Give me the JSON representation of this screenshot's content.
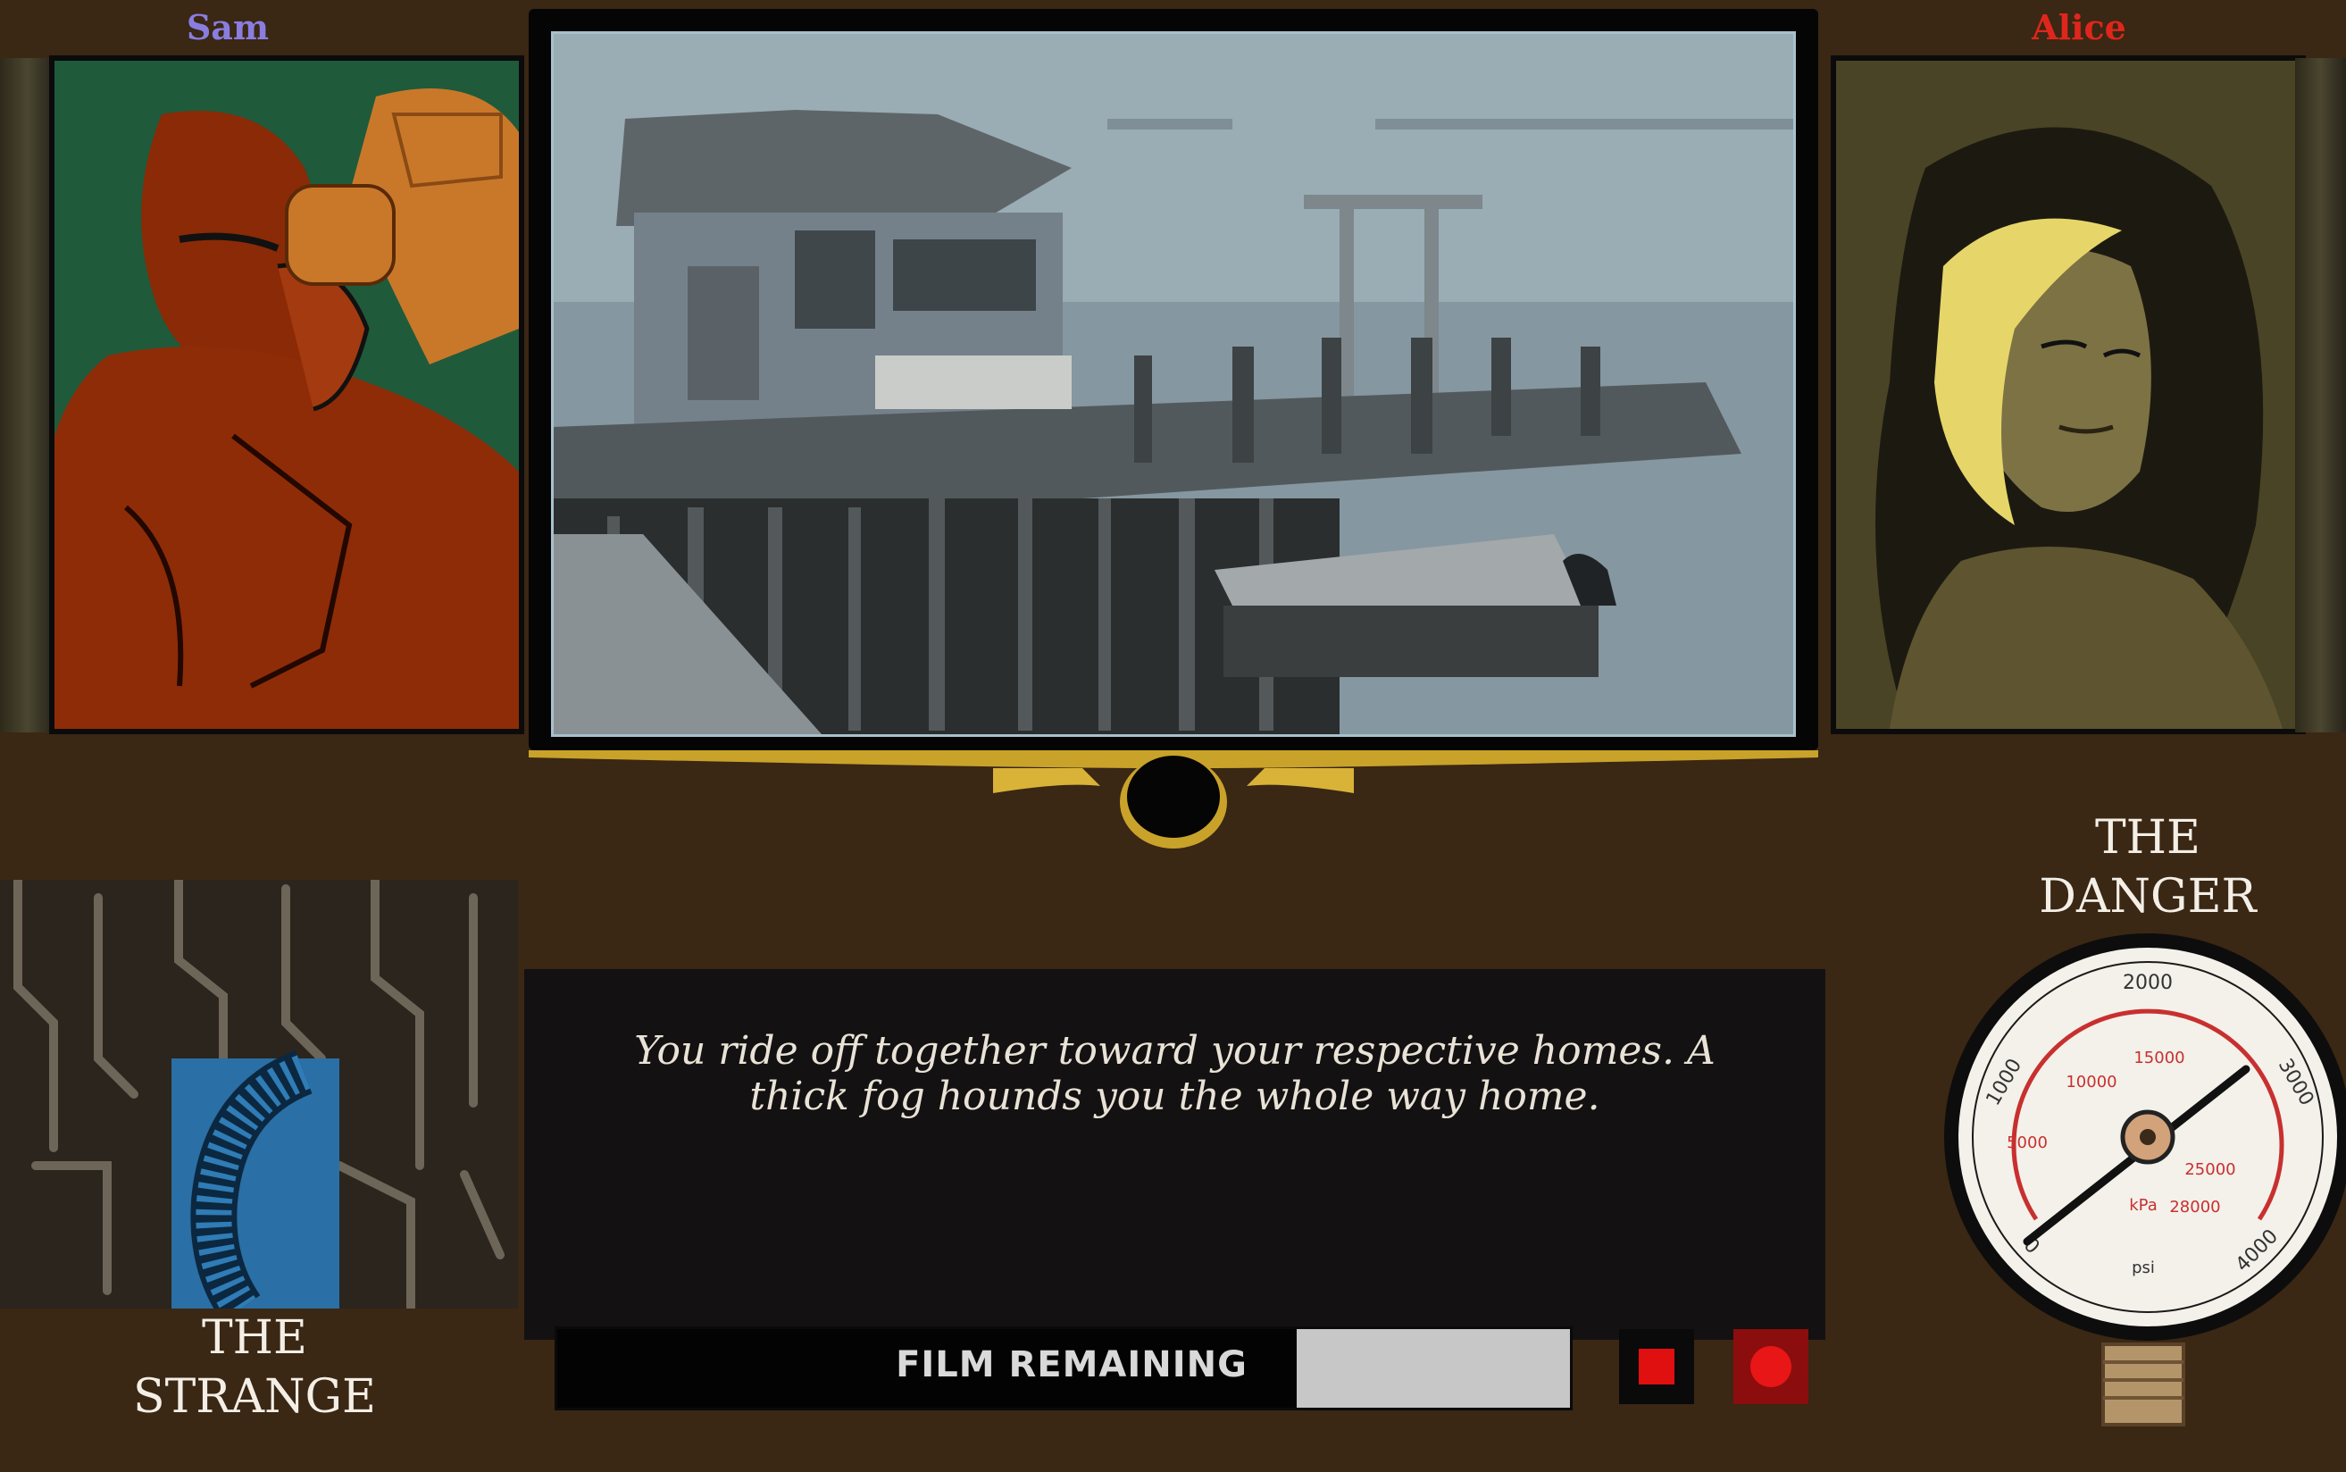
{
  "characters": {
    "left": {
      "name": "Sam",
      "name_color": "#8a7de0"
    },
    "right": {
      "name": "Alice",
      "name_color": "#e0261c"
    }
  },
  "dialogue": {
    "text": "You ride off together toward your respective homes. A thick fog hounds you the whole way home."
  },
  "film": {
    "label": "FILM REMAINING",
    "remaining_fraction": 0.73
  },
  "controls": {
    "stop_icon": "stop-icon",
    "record_icon": "record-icon"
  },
  "strange": {
    "caption_line1": "THE",
    "caption_line2": "STRANGE"
  },
  "danger": {
    "caption_line1": "THE",
    "caption_line2": "DANGER",
    "gauge": {
      "outer_ticks": [
        "2000",
        "3000",
        "4000",
        "1000",
        "0"
      ],
      "inner_ticks": [
        "15000",
        "10000",
        "5000",
        "25000",
        "28000"
      ],
      "unit_inner": "kPa",
      "unit_outer": "psi",
      "needle_value_psi": 2600
    }
  },
  "colors": {
    "background": "#3a2714",
    "accent_gold": "#c9a22a",
    "stop_red": "#e01010",
    "record_red": "#c01010"
  }
}
